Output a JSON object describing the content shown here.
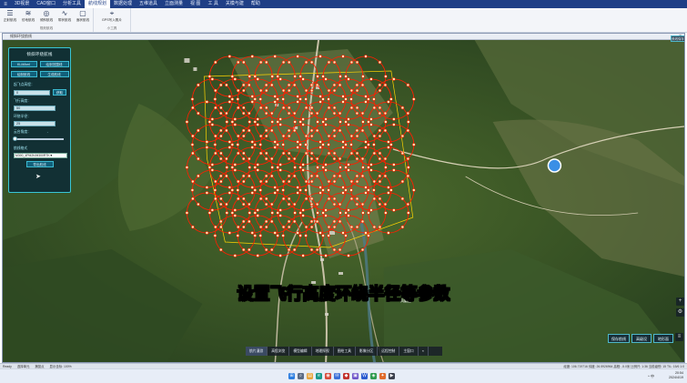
{
  "menubar": {
    "logo": "≡",
    "items": [
      "3D视景",
      "CAD窗口",
      "分析工具",
      "航线规划",
      "数据处理",
      "五维道具",
      "立面测量",
      "视  图",
      "工  具",
      "关模与建",
      "帮助"
    ],
    "active_index": 3
  },
  "ribbon": {
    "group1": {
      "buttons": [
        {
          "label": "正射航线",
          "icon": "☰"
        },
        {
          "label": "仿地航线",
          "icon": "≋"
        },
        {
          "label": "倾斜航线",
          "icon": "◎"
        },
        {
          "label": "带状航线",
          "icon": "∿"
        },
        {
          "label": "面状航线",
          "icon": "▢"
        }
      ],
      "label": "规划航线"
    },
    "group2": {
      "buttons": [
        {
          "label": "GPS写入照片",
          "icon": "⌖"
        }
      ],
      "label": "小工具"
    }
  },
  "map_window": {
    "title": "倾斜环绕航线",
    "close": "×",
    "top_right_button": "航线保存"
  },
  "panel": {
    "title": "倾斜环绕航线",
    "buttons_row1": [
      "KLM/kml",
      "绘制范围线"
    ],
    "buttons_row2": [
      "绘制航线",
      "生成航线"
    ],
    "height_label": "起飞点高程：",
    "height_value": "0",
    "height_button": "获取",
    "flight_height_label": "飞行高度：",
    "flight_height_value": "50",
    "radius_label": "环绕半径：",
    "radius_value": "25",
    "gimbal_label": "云台角度：",
    "gimbal_value": "-",
    "gimbal_slider_fraction": 0.0,
    "format_label": "航线格式",
    "format_value": "M300_4PM2K/M300RTK▼",
    "export_button": "导出航线"
  },
  "map_label": "凤凰庄",
  "subtitle": "设置飞行高度环绕半径等参数",
  "bottom_right_buttons": [
    "保存航线",
    "高级设",
    "地形面"
  ],
  "toolstrip": {
    "items": [
      "航片漫游",
      "高程浏览",
      "模型编辑",
      "地理探视",
      "图绘工具",
      "影像分区",
      "远程控制",
      "主窗口",
      "«"
    ],
    "active_index": 0
  },
  "statusbar": {
    "items": [
      "Ready",
      "选择单元",
      "捕捉点",
      "显示坐标: 100%"
    ],
    "coords": "经度: 106.719716  纬度: 26.5926964  高程: -5.0米  比例尺: 1:36  当前级别: 15  TIL: 15/6 1:0"
  },
  "taskbar": {
    "apps": [
      {
        "name": "start-icon",
        "glyph": "⊞",
        "color": "#2b7de0"
      },
      {
        "name": "search-icon",
        "glyph": "⌕",
        "color": "#5b6b85"
      },
      {
        "name": "files-icon",
        "glyph": "▤",
        "color": "#e8a43b"
      },
      {
        "name": "edge-icon",
        "glyph": "e",
        "color": "#1b9a8a"
      },
      {
        "name": "chrome-icon",
        "glyph": "◉",
        "color": "#d84a3a"
      },
      {
        "name": "mail-icon",
        "glyph": "✉",
        "color": "#3b6fd8"
      },
      {
        "name": "app-icon",
        "glyph": "◆",
        "color": "#c2322e"
      },
      {
        "name": "store-icon",
        "glyph": "▣",
        "color": "#6d55c9"
      },
      {
        "name": "word-icon",
        "glyph": "W",
        "color": "#2b5bd0"
      },
      {
        "name": "map-app-icon",
        "glyph": "◈",
        "color": "#2e9b4f"
      },
      {
        "name": "tool-icon",
        "glyph": "✦",
        "color": "#e06b2b"
      },
      {
        "name": "terminal-icon",
        "glyph": "▶",
        "color": "#3a3f4c"
      }
    ],
    "sys": "^  中  ",
    "time": "20:54",
    "date": "2024/4/19"
  },
  "colors": {
    "flight_path": "#ff1e00",
    "waypoint_fill": "#fff4c0",
    "boundary": "#ffd400",
    "marker": "#3a8fe6"
  }
}
